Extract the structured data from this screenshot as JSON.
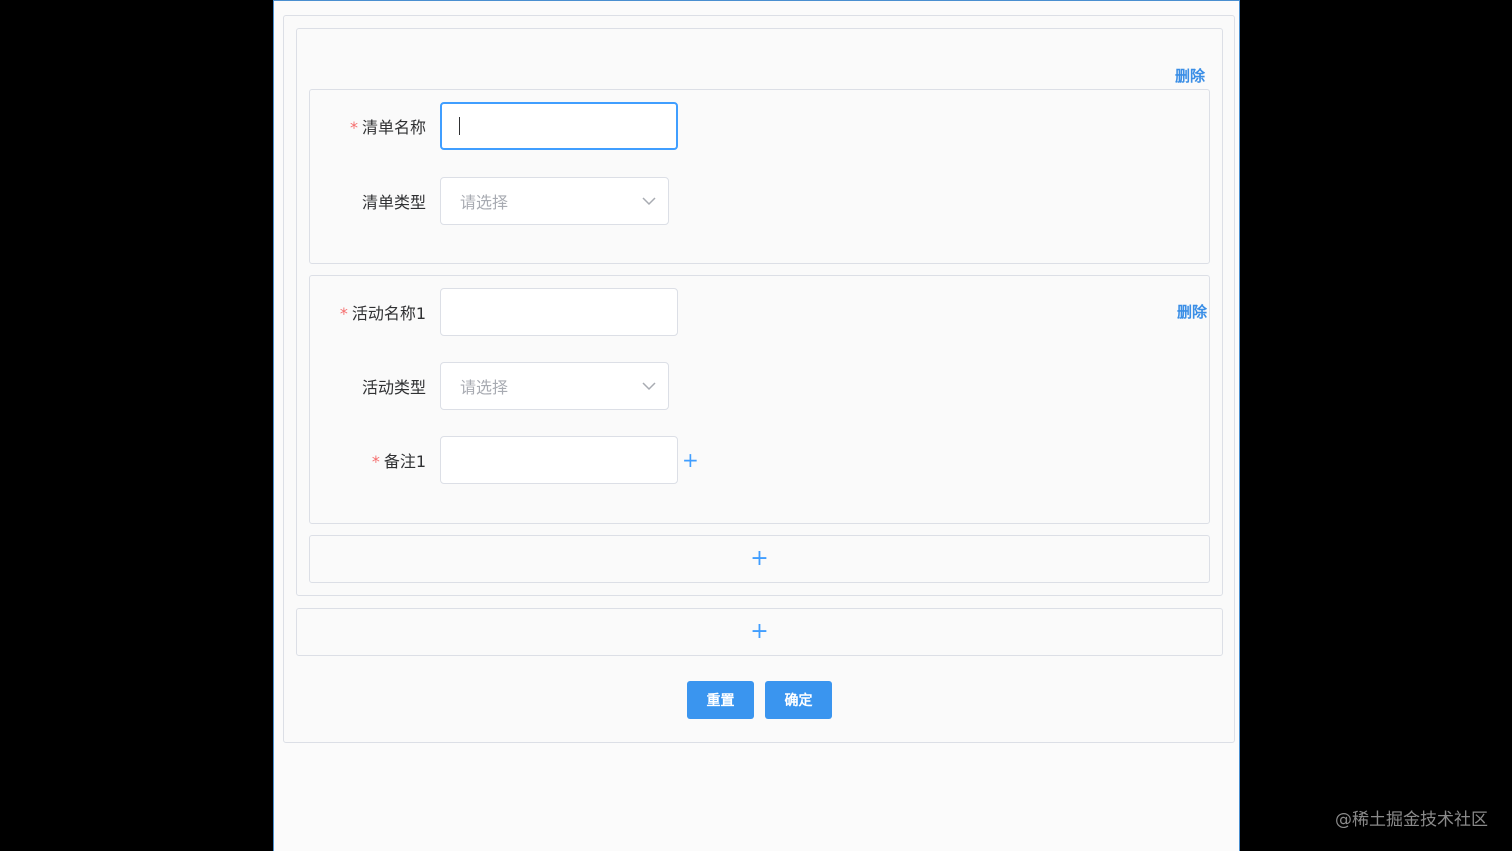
{
  "list": {
    "delete_label": "删除",
    "name_label": "清单名称",
    "name_value": "",
    "type_label": "清单类型",
    "type_placeholder": "请选择"
  },
  "activity": {
    "delete_label": "删除",
    "name_label": "活动名称1",
    "name_value": "",
    "type_label": "活动类型",
    "type_placeholder": "请选择",
    "note_label": "备注1",
    "note_value": ""
  },
  "add_symbol": "+",
  "buttons": {
    "reset": "重置",
    "confirm": "确定"
  },
  "watermark": "@稀土掘金技术社区",
  "colors": {
    "accent": "#409eff",
    "required": "#f56c6c",
    "button": "#3a95ef"
  },
  "icons": {
    "select_arrow": "chevron-down-icon",
    "add": "plus-icon"
  }
}
